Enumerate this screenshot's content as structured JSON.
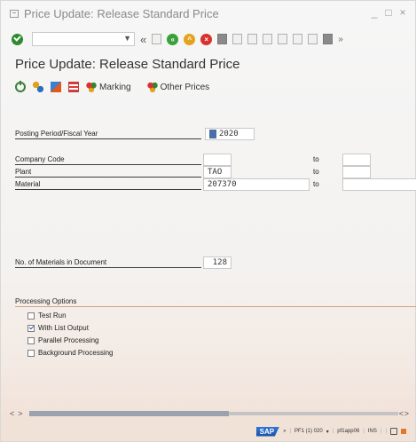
{
  "window": {
    "title": "Price Update: Release Standard Price",
    "controls": [
      "_",
      "□",
      "×"
    ]
  },
  "toolbar": {
    "command_value": "",
    "more": "»"
  },
  "screen": {
    "title": "Price Update: Release Standard Price"
  },
  "app_toolbar": {
    "marking_label": "Marking",
    "other_prices_label": "Other Prices"
  },
  "form": {
    "posting_period": {
      "label": "Posting Period/Fiscal Year",
      "period": "",
      "year": "2020"
    },
    "company_code": {
      "label": "Company Code",
      "from": "",
      "to_label": "to",
      "to": ""
    },
    "plant": {
      "label": "Plant",
      "from": "TAO",
      "to_label": "to",
      "to": ""
    },
    "material": {
      "label": "Material",
      "from": "207370",
      "to_label": "to",
      "to": ""
    },
    "num_materials": {
      "label": "No. of Materials in Document",
      "value": "128"
    }
  },
  "processing": {
    "title": "Processing Options",
    "options": [
      {
        "label": "Test Run",
        "checked": false
      },
      {
        "label": "With List Output",
        "checked": true
      },
      {
        "label": "Parallel Processing",
        "checked": false
      },
      {
        "label": "Background Processing",
        "checked": false
      }
    ]
  },
  "status": {
    "logo": "SAP",
    "nav": "»",
    "session": "PF1 (1) 020",
    "server": "pf1app06",
    "mode": "INS"
  }
}
